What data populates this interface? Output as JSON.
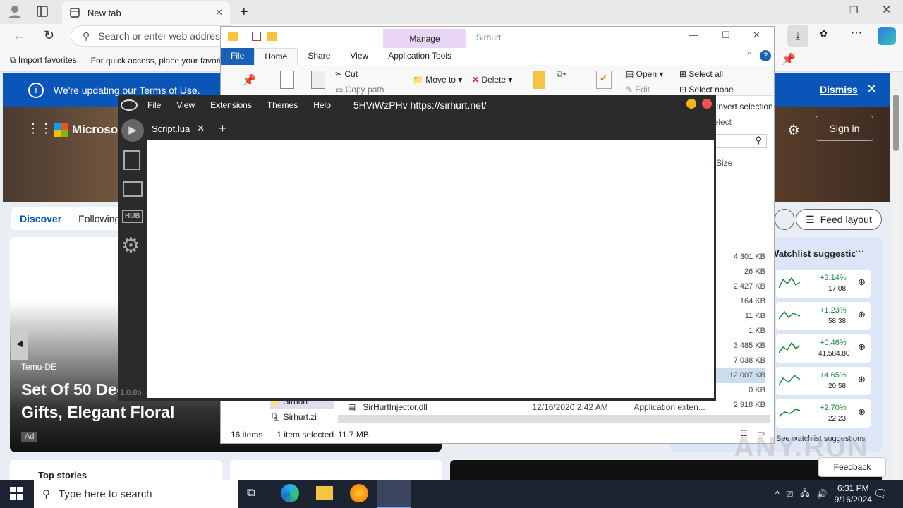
{
  "browser": {
    "tab_title": "New tab",
    "address_placeholder": "Search or enter web address",
    "fav_import": "Import favorites",
    "fav_hint": "For quick access, place your favorites here"
  },
  "notice": {
    "text": "We're updating our Terms of Use.",
    "dismiss": "Dismiss"
  },
  "newtab": {
    "brand": "Microsoft",
    "signin": "Sign in",
    "nav_discover": "Discover",
    "nav_following": "Following",
    "feed_layout": "Feed layout",
    "ad_source": "Temu-DE",
    "ad_title": "Set Of 50 Decorative Candy Gifts, Elegant Floral",
    "ad_badge": "Ad",
    "top_stories": "Top stories",
    "watchlist_title": "Watchlist suggestions",
    "watchlist_more": "See watchlist suggestions",
    "feedback": "Feedback",
    "stocks": [
      {
        "change": "+3.14%",
        "price": "17.08"
      },
      {
        "change": "+1.23%",
        "price": "58.38"
      },
      {
        "change": "+0.46%",
        "price": "41,584.80"
      },
      {
        "change": "+4.65%",
        "price": "20.58"
      },
      {
        "change": "+2.70%",
        "price": "22.23"
      }
    ]
  },
  "explorer": {
    "title": "Sirhurt",
    "manage": "Manage",
    "tabs": [
      "File",
      "Home",
      "Share",
      "View",
      "Application Tools"
    ],
    "ribbon": {
      "cut": "Cut",
      "copy_path": "Copy path",
      "move_to": "Move to",
      "delete": "Delete",
      "open": "Open",
      "edit": "Edit",
      "select_all": "Select all",
      "select_none": "Select none",
      "invert": "Invert selection",
      "select": "Select"
    },
    "size_header": "Size",
    "sizes": [
      "4,301 KB",
      "26 KB",
      "2,427 KB",
      "164 KB",
      "11 KB",
      "1 KB",
      "3,485 KB",
      "7,038 KB",
      "12,007 KB",
      "0 KB",
      "2,918 KB"
    ],
    "last_file": {
      "name": "SirHurtInjector.dll",
      "date": "12/16/2020 2:42 AM",
      "type": "Application exten..."
    },
    "nav_items": [
      "Sirhurt",
      "Sirhurt.zi"
    ],
    "status_items": "16 items",
    "status_selected": "1 item selected",
    "status_size": "11.7 MB"
  },
  "sirhurt": {
    "menu": [
      "File",
      "View",
      "Extensions",
      "Themes",
      "Help"
    ],
    "caption": "5HViWzPHv https://sirhurt.net/",
    "tab": "Script.lua",
    "version": "1.0.8b"
  },
  "taskbar": {
    "search": "Type here to search",
    "time": "6:31 PM",
    "date": "9/16/2024"
  },
  "watermark": "ANY.RUN"
}
